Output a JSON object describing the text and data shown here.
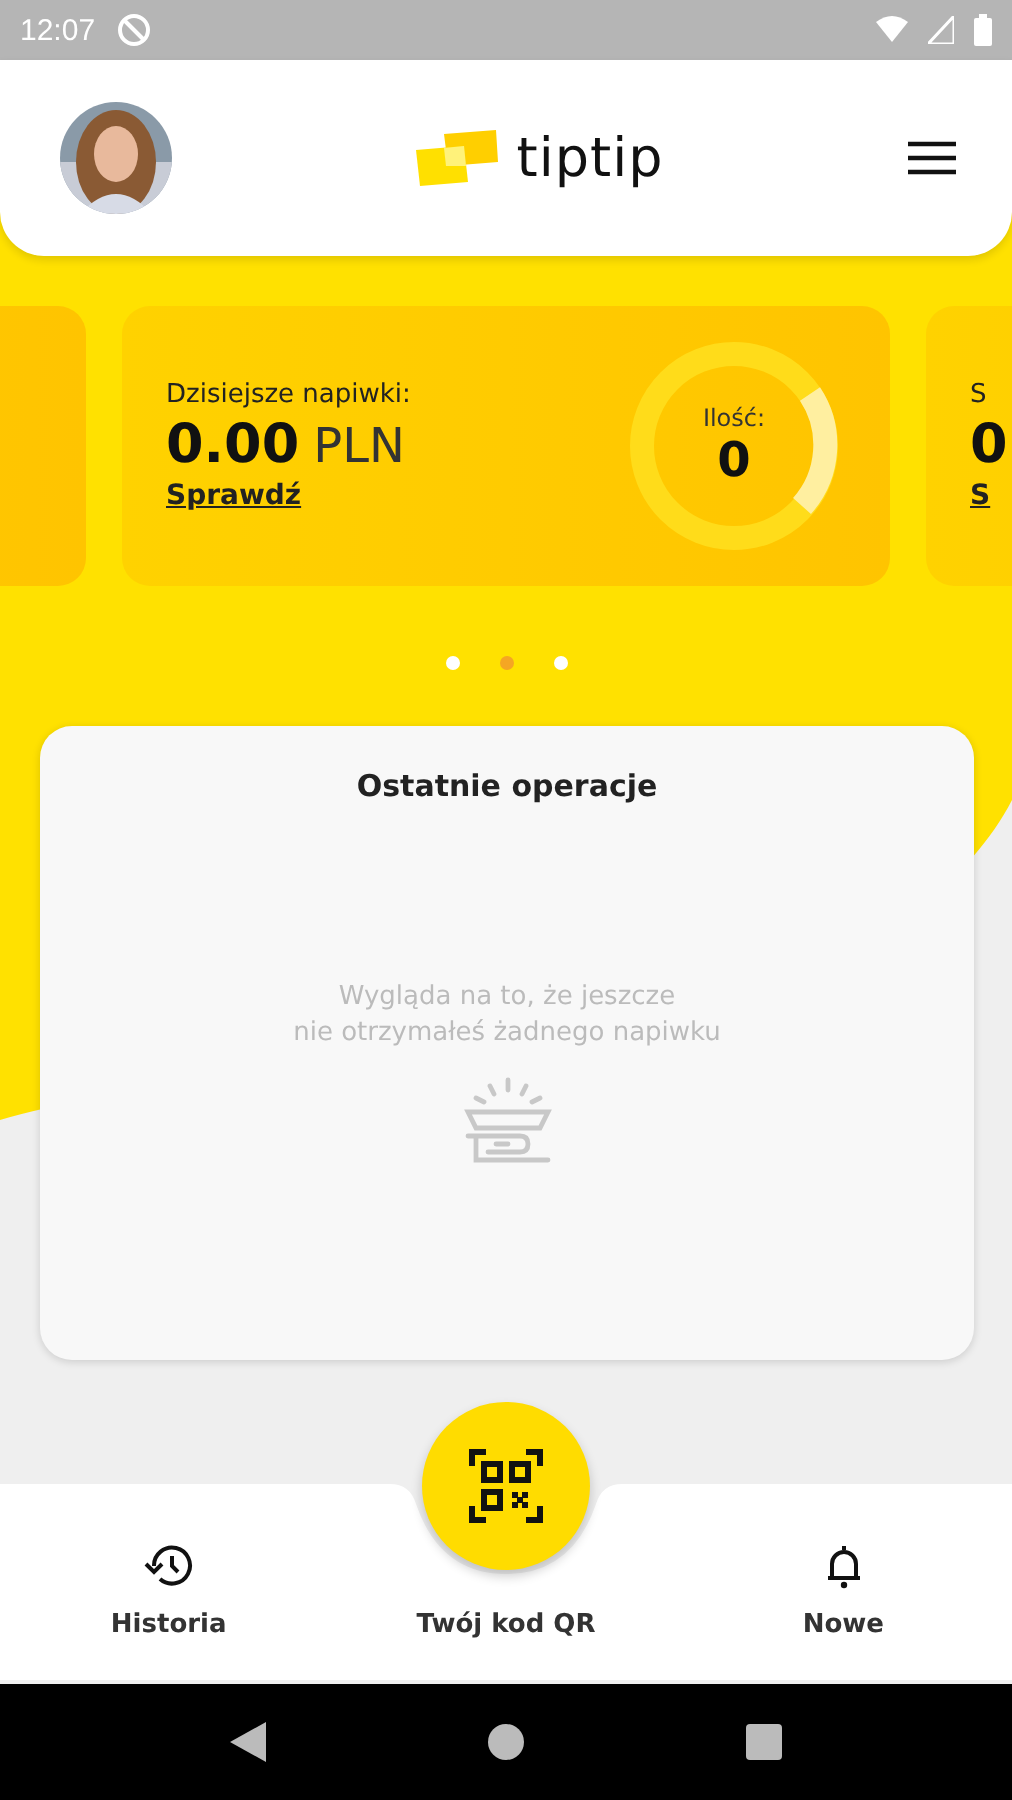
{
  "status_bar": {
    "time": "12:07"
  },
  "header": {
    "logo_text": "tiptip"
  },
  "cards": [
    {
      "kind": "blank"
    },
    {
      "kind": "summary",
      "label": "Dzisiejsze napiwki:",
      "amount": "0.00",
      "currency": "PLN",
      "link": "Sprawdź",
      "count_label": "Ilość:",
      "count": "0"
    },
    {
      "kind": "summary",
      "label": "S",
      "amount": "0",
      "link": "S"
    }
  ],
  "dots": [
    {
      "selected": false
    },
    {
      "selected": true
    },
    {
      "selected": false
    }
  ],
  "recent": {
    "title": "Ostatnie operacje",
    "empty_message": "Wygląda na to, że jeszcze\nnie otrzymałeś żadnego napiwku"
  },
  "bottom_nav": [
    {
      "kind": "history",
      "label": "Historia"
    },
    {
      "kind": "qr",
      "label": "Twój kod QR"
    },
    {
      "kind": "bell",
      "label": "Nowe"
    }
  ]
}
